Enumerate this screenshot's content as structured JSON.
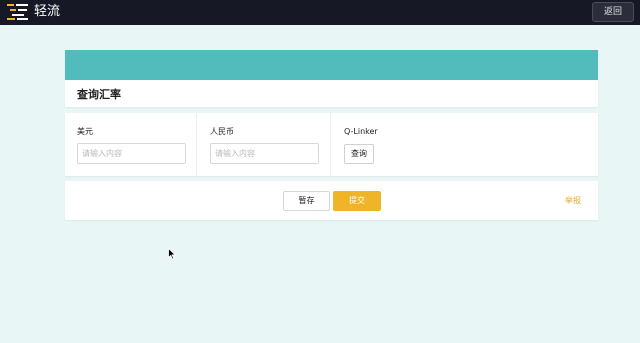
{
  "app": {
    "title": "轻流",
    "logo_icon": "app-logo-icon",
    "back_label": "返回"
  },
  "page": {
    "title": "查询汇率",
    "banner_color": "#52bcbc"
  },
  "form": {
    "usd": {
      "label": "美元",
      "placeholder": "请输入内容",
      "value": ""
    },
    "cny": {
      "label": "人民币",
      "placeholder": "请输入内容",
      "value": ""
    },
    "linker": {
      "label": "Q-Linker",
      "button_label": "查询"
    }
  },
  "actions": {
    "save_label": "暂存",
    "submit_label": "提交",
    "report_label": "举报",
    "accent_color": "#f0b429"
  }
}
